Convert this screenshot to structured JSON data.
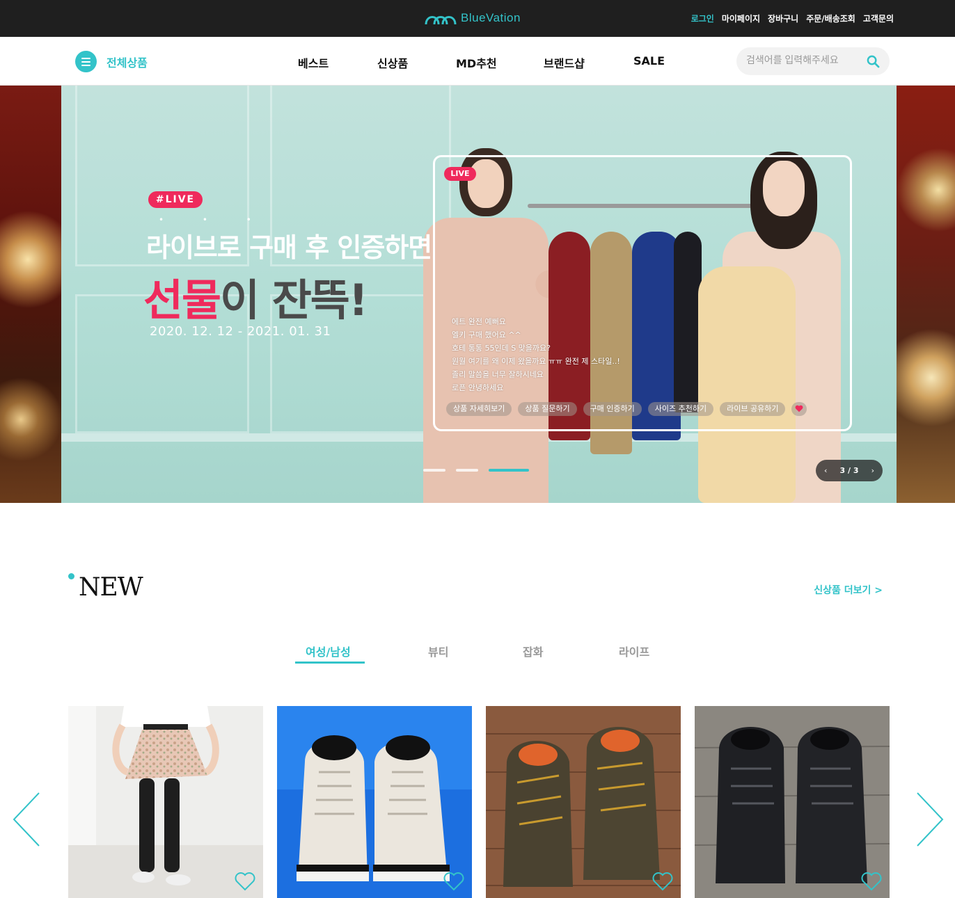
{
  "brand": {
    "name": "BlueVation",
    "accent": "#33c3c9",
    "pink": "#ef2a5c"
  },
  "topbar": {
    "links": [
      "로그인",
      "마이페이지",
      "장바구니",
      "주문/배송조회",
      "고객문의"
    ]
  },
  "nav": {
    "all_label": "전체상품",
    "items": [
      "베스트",
      "신상품",
      "MD추천",
      "브랜드샵",
      "SALE"
    ],
    "search_placeholder": "검색어를 입력해주세요"
  },
  "hero": {
    "tag": "#LIVE",
    "line1": "라이브로 구매 후 인증하면",
    "line2_highlight": "선물",
    "line2_rest": "이 잔뜩!",
    "date": "2020. 12. 12 - 2021. 01. 31",
    "live_badge": "LIVE",
    "chat": [
      "에트  완전 예뻐요",
      "엘키  구매 했어요 ^^",
      "호테  통통 55인데 S 맞을까요?",
      "원월  여기를 왜 이제 왔을까요 ㅠㅠ 완전 제 스타일..!",
      "졸리  말씀을 너무 잘하시네요",
      "로픈  안녕하세요"
    ],
    "buttons": [
      "상품 자세히보기",
      "상품 질문하기",
      "구매 인증하기",
      "사이즈 추천하기",
      "라이브 공유하기"
    ],
    "slide_current": 3,
    "slide_total": 3,
    "counter": "3 / 3"
  },
  "new_section": {
    "title": "NEW",
    "more_label": "신상품 더보기 >",
    "tabs": [
      "여성/남성",
      "뷰티",
      "잡화",
      "라이프"
    ],
    "active_tab": 0,
    "products": [
      {
        "image": "skirt-leggings-photo"
      },
      {
        "image": "white-sneakers-photo"
      },
      {
        "image": "hiking-shoes-photo"
      },
      {
        "image": "black-running-shoes-photo"
      }
    ]
  }
}
